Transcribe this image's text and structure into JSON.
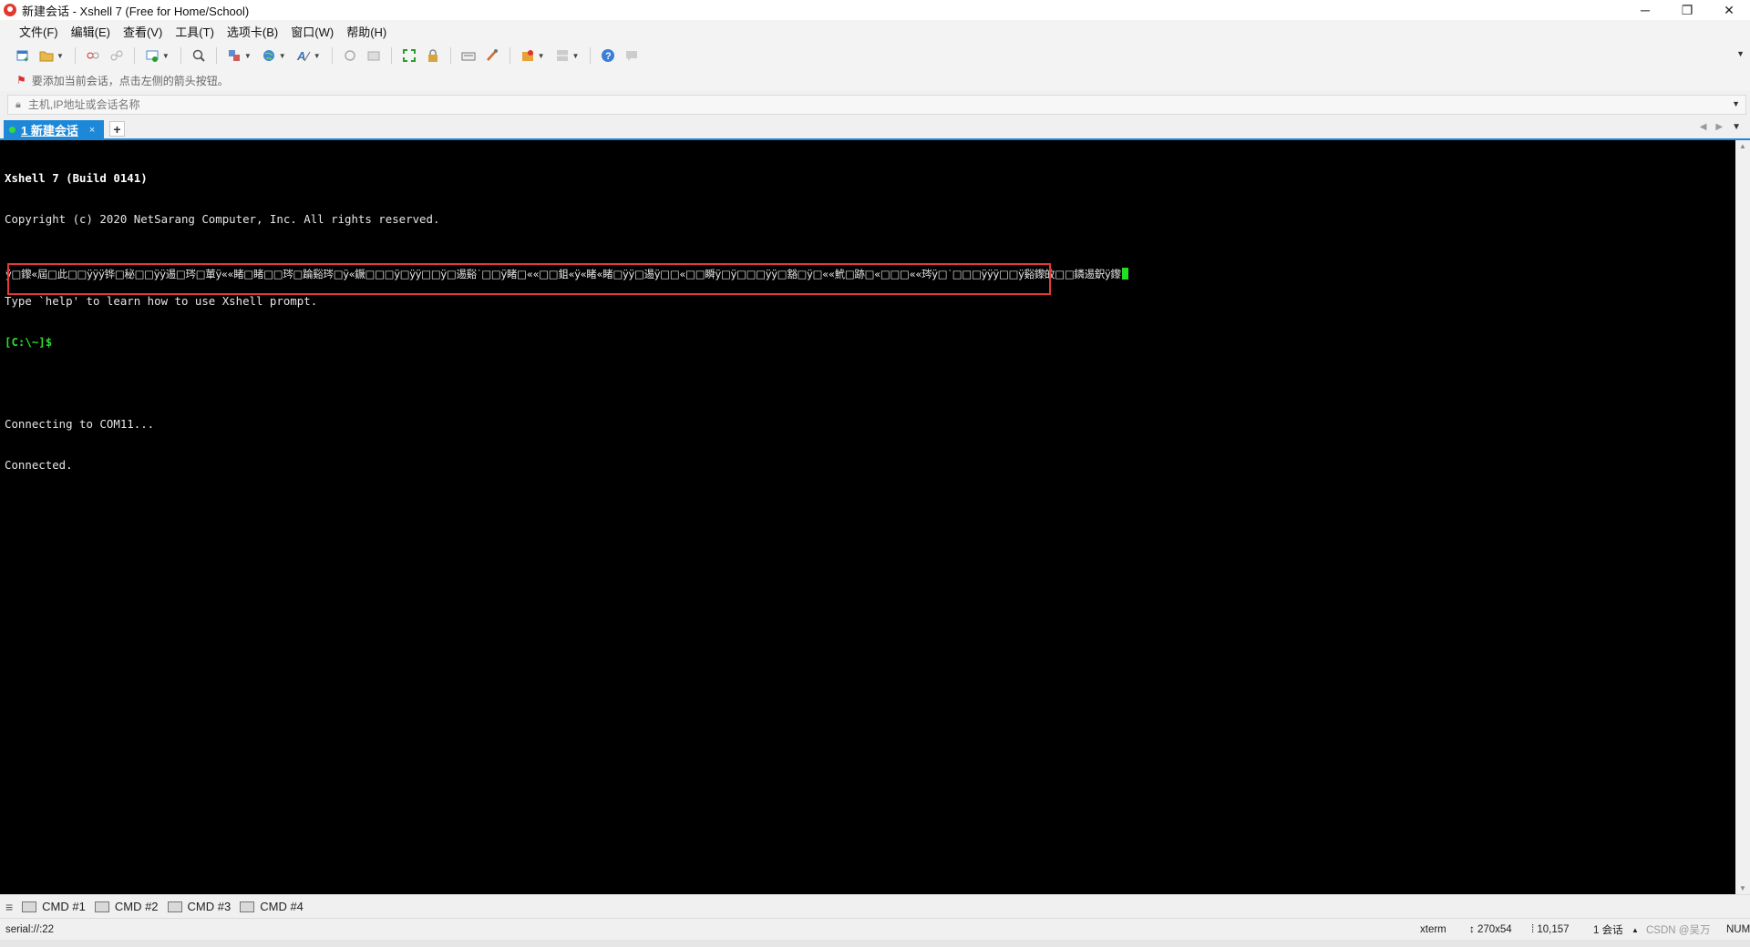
{
  "window": {
    "title": "新建会话 - Xshell 7 (Free for Home/School)",
    "controls": {
      "minimize": "─",
      "restore": "❐",
      "close": "✕"
    }
  },
  "menu": [
    "文件(F)",
    "编辑(E)",
    "查看(V)",
    "工具(T)",
    "选项卡(B)",
    "窗口(W)",
    "帮助(H)"
  ],
  "toolbar": {
    "icons": [
      "new-session-icon",
      "open-folder-icon",
      "connect-icon",
      "disconnect-icon",
      "reconnect-icon",
      "search-icon",
      "layout-icon",
      "globe-icon",
      "font-icon",
      "transfer-icon",
      "sftp-icon",
      "fullscreen-icon",
      "lock-icon",
      "keyboard-icon",
      "compose-icon",
      "script-icon",
      "layout-grid-icon",
      "help-icon",
      "chat-icon"
    ]
  },
  "hint": {
    "text": "要添加当前会话，点击左侧的箭头按钮。"
  },
  "address": {
    "placeholder": "主机,IP地址或会话名称"
  },
  "tabs": [
    {
      "index": "1",
      "label": "1 新建会话",
      "close": "×",
      "active": true
    }
  ],
  "tab_add": "+",
  "terminal": {
    "lines": [
      {
        "text": "Xshell 7 (Build 0141)",
        "style": "bold"
      },
      {
        "text": "Copyright (c) 2020 NetSarang Computer, Inc. All rights reserved.",
        "style": "normal"
      },
      {
        "text": "",
        "style": "normal"
      },
      {
        "text": "Type `help' to learn how to use Xshell prompt.",
        "style": "normal"
      },
      {
        "text": "[C:\\~]$",
        "style": "prompt"
      },
      {
        "text": "",
        "style": "normal"
      },
      {
        "text": "Connecting to COM11...",
        "style": "normal"
      },
      {
        "text": "Connected.",
        "style": "normal"
      }
    ],
    "garbled_output": "ÿ□鑗«屆□此□□ÿÿÿ铧□秘□□ÿÿ逷□琌□莗ÿ««睹□睹□□琌□踚谿琌□ÿ«鐝□□□ÿ□ÿÿ□□ÿ□逷谿˙□□ÿ睹□««□□鉏«ÿ«睹«睹□ÿÿ□逷ÿ□□«□□瞬ÿ□ÿ□□□ÿÿ□豁□ÿ□««鮘□跡□«□□□««琌ÿ□˙□□□ÿÿÿ□□ÿ谿鑗敀□□鏻逷鈬ÿ鑗",
    "cursor_color": "#21e021",
    "highlight_color": "#e53935"
  },
  "quick_commands": [
    "CMD #1",
    "CMD #2",
    "CMD #3",
    "CMD #4"
  ],
  "status": {
    "connection": "serial://:22",
    "terminal_type": "xterm",
    "size": "↕ 270x54",
    "position": "⁞ 10,157",
    "sessions": "1 会话",
    "caret": "▲",
    "watermark": "CSDN @吴万",
    "num": "NUM"
  },
  "colors": {
    "accent": "#1e88d8",
    "terminal_bg": "#000000",
    "prompt": "#2edc2e"
  }
}
